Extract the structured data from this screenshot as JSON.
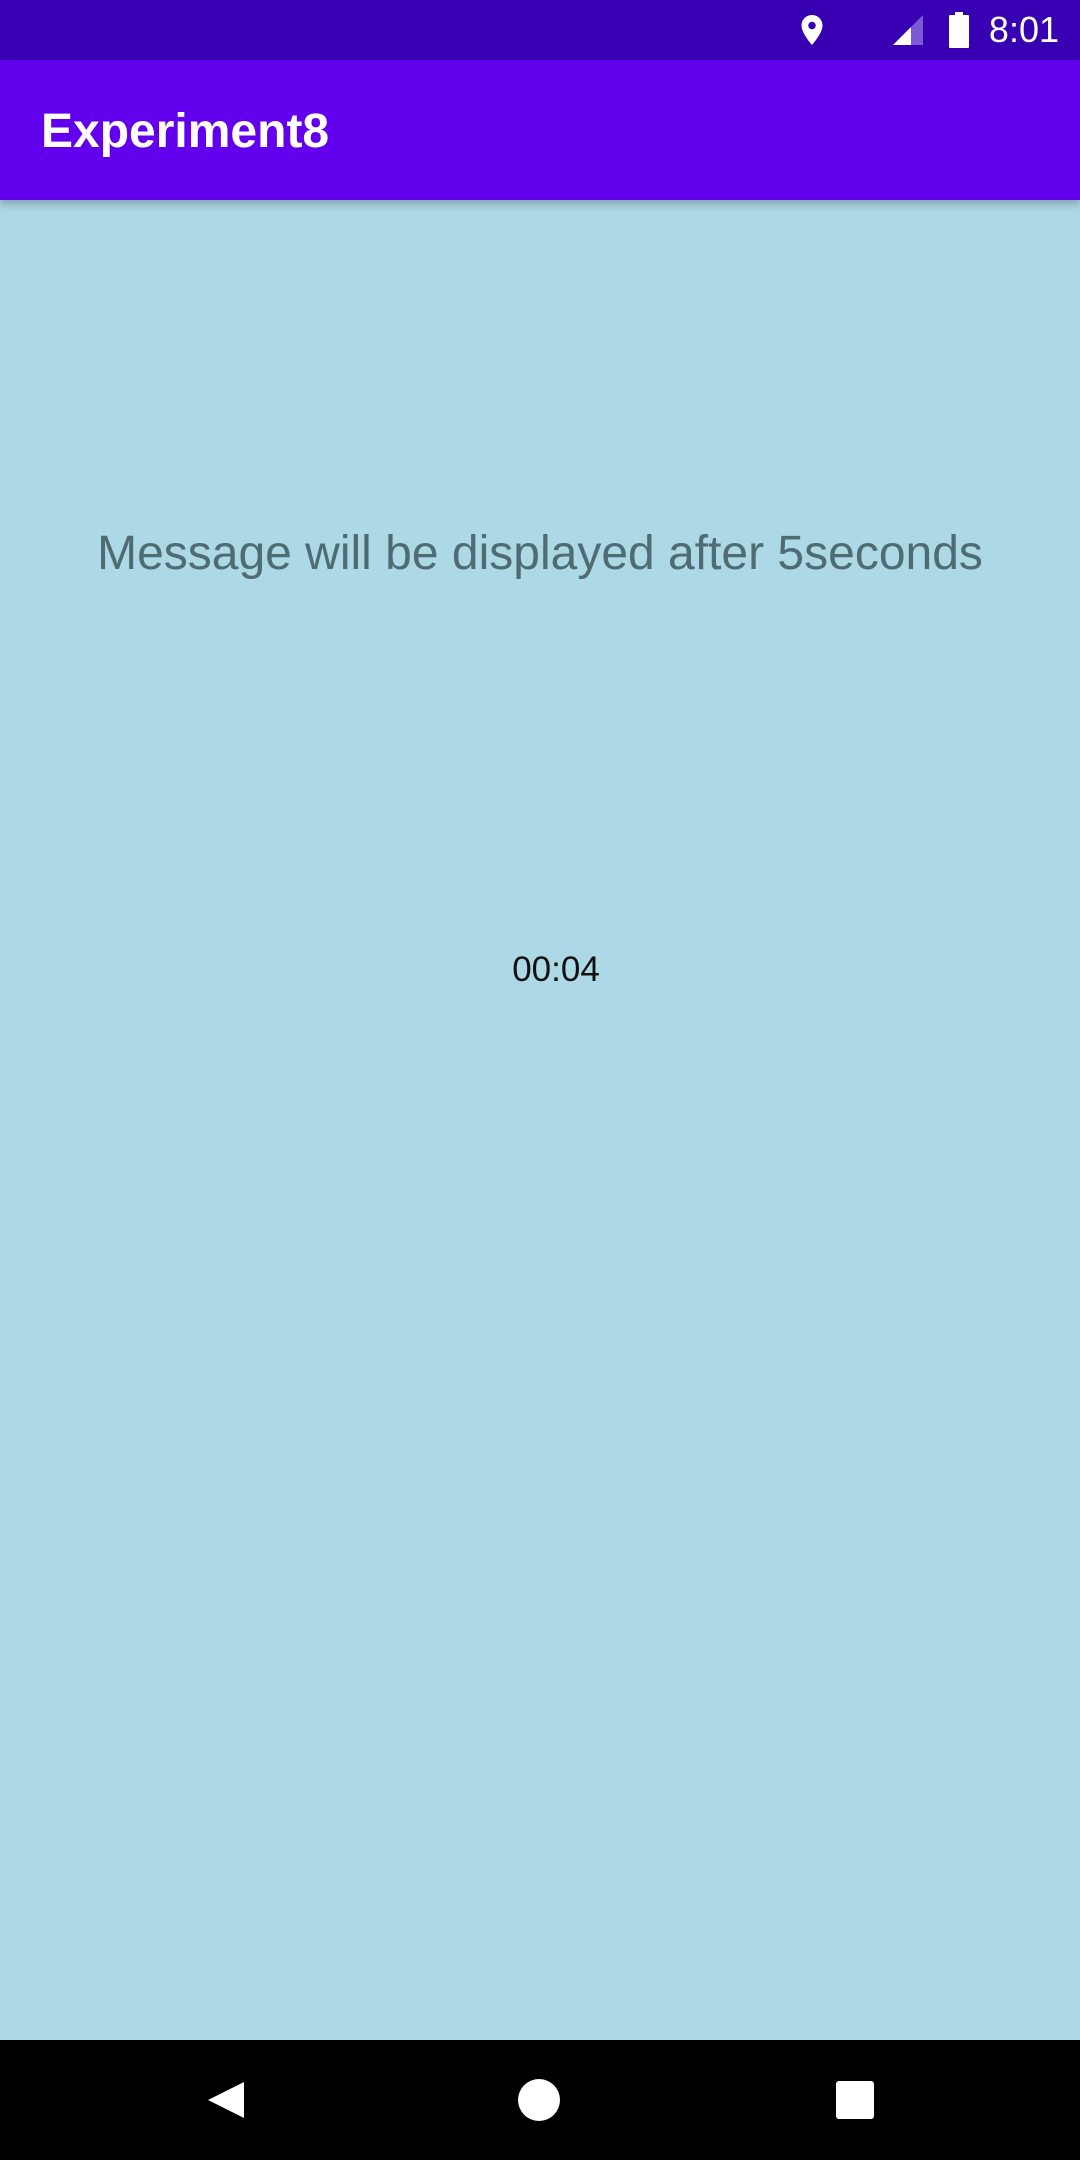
{
  "status_bar": {
    "time": "8:01",
    "icons": [
      "location-icon",
      "cell-signal-icon",
      "battery-icon"
    ]
  },
  "app_bar": {
    "title": "Experiment8",
    "color": "#6200ee"
  },
  "main": {
    "message": "Message will be displayed after 5seconds",
    "timer": "00:04",
    "background_color": "#add8e6"
  },
  "nav_bar": {
    "buttons": [
      "back-icon",
      "home-icon",
      "recents-icon"
    ]
  }
}
